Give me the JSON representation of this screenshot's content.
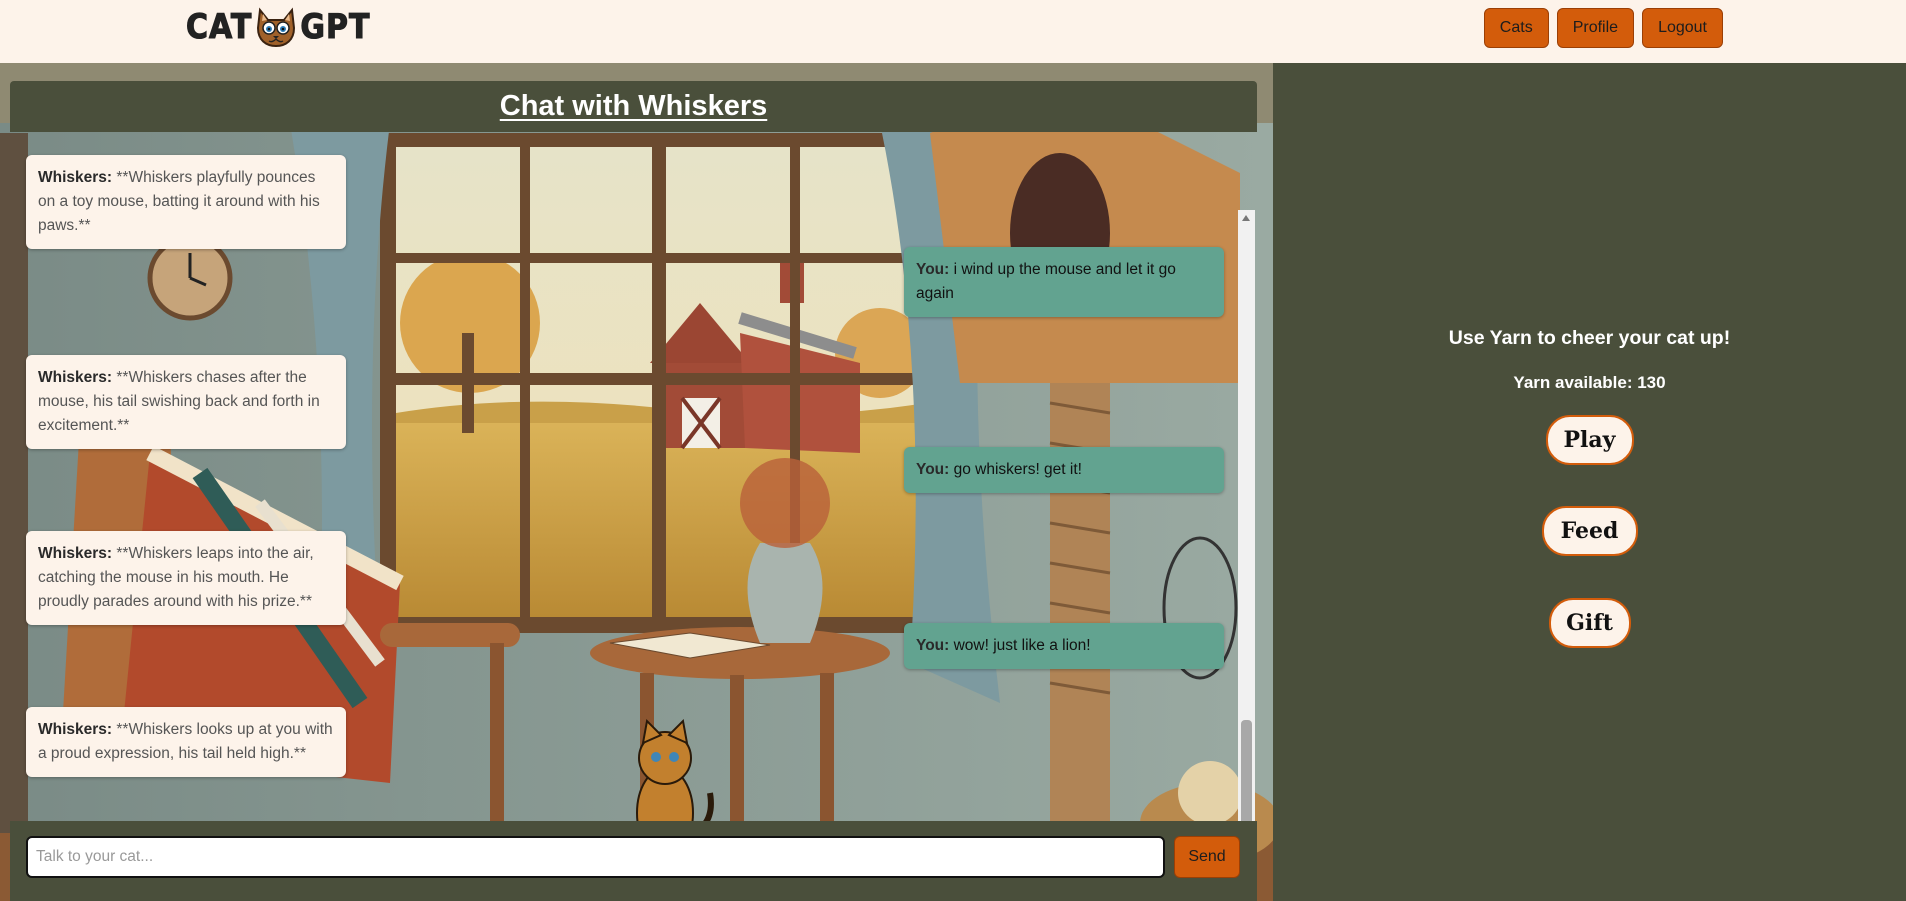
{
  "header": {
    "logo_left": "CAT",
    "logo_right": "GPT",
    "logo_icon": "cat-face-icon",
    "nav": [
      {
        "label": "Cats"
      },
      {
        "label": "Profile"
      },
      {
        "label": "Logout"
      }
    ]
  },
  "chat": {
    "title": "Chat with Whiskers",
    "messages": [
      {
        "sender": "Whiskers:",
        "text": " **Whiskers playfully pounces on a toy mouse, batting it around with his paws.**",
        "side": "cat"
      },
      {
        "sender": "You:",
        "text": " i wind up the mouse and let it go again",
        "side": "user"
      },
      {
        "sender": "Whiskers:",
        "text": " **Whiskers chases after the mouse, his tail swishing back and forth in excitement.**",
        "side": "cat"
      },
      {
        "sender": "You:",
        "text": " go whiskers! get it!",
        "side": "user"
      },
      {
        "sender": "Whiskers:",
        "text": " **Whiskers leaps into the air, catching the mouse in his mouth. He proudly parades around with his prize.**",
        "side": "cat"
      },
      {
        "sender": "You:",
        "text": " wow! just like a lion!",
        "side": "user"
      },
      {
        "sender": "Whiskers:",
        "text": " **Whiskers looks up at you with a proud expression, his tail held high.**",
        "side": "cat"
      }
    ],
    "input_placeholder": "Talk to your cat...",
    "input_value": "",
    "send_label": "Send"
  },
  "sidebar": {
    "heading": "Use Yarn to cheer your cat up!",
    "yarn_label": "Yarn available: 130",
    "actions": [
      {
        "label": "Play"
      },
      {
        "label": "Feed"
      },
      {
        "label": "Gift"
      }
    ]
  },
  "colors": {
    "accent": "#d35c0b",
    "panel": "#4a4f3b",
    "cream": "#fdf3ea",
    "user_bubble": "#62a390"
  }
}
